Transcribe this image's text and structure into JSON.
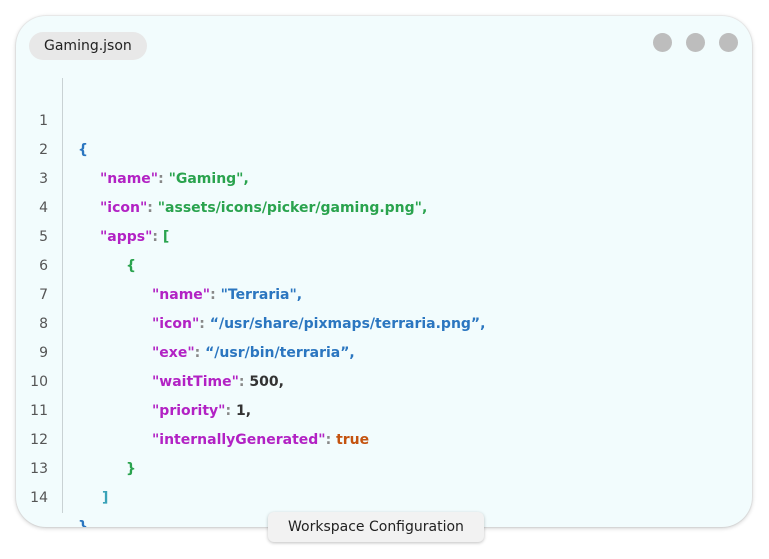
{
  "window": {
    "file_name": "Gaming.json",
    "window_controls": [
      "circle-icon",
      "circle-icon",
      "circle-icon"
    ]
  },
  "editor": {
    "line_numbers": [
      "1",
      "2",
      "3",
      "4",
      "5",
      "6",
      "7",
      "8",
      "9",
      "10",
      "11",
      "12",
      "13",
      "14"
    ],
    "tokens": {
      "open_brace": "{",
      "close_brace": "}",
      "open_bracket": "[",
      "close_bracket": "]",
      "colon": ": ",
      "comma": ",",
      "key_name": "\"name\"",
      "key_icon": "\"icon\"",
      "key_apps": "\"apps\"",
      "key_exe": "\"exe\"",
      "key_waitTime": "\"waitTime\"",
      "key_priority": "\"priority\"",
      "key_internallyGenerated": "\"internallyGenerated\"",
      "val_name": "\"Gaming\"",
      "val_icon": "\"assets/icons/picker/gaming.png\"",
      "app_name": "\"Terraria\"",
      "app_icon": "“/usr/share/pixmaps/terraria.png”",
      "app_exe": "“/usr/bin/terraria”",
      "app_waitTime": "500",
      "app_priority": "1",
      "app_internallyGenerated": "true"
    }
  },
  "caption": "Workspace Configuration",
  "colors": {
    "key": "#b222c4",
    "string_green": "#2aa34e",
    "string_blue": "#2b76c0",
    "boolean": "#c4530f",
    "window_bg": "#f2fcfd"
  }
}
